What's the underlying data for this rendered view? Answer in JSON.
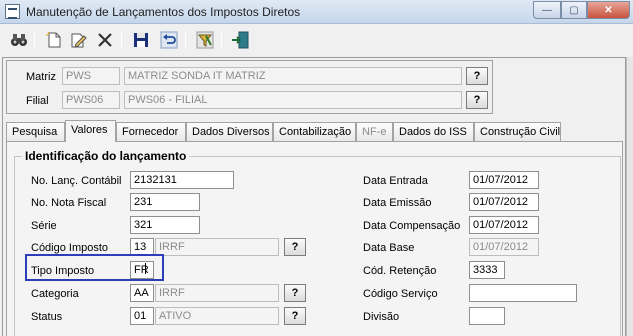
{
  "window": {
    "title": "Manutenção de Lançamentos dos Impostos Diretos",
    "icon": "app-window-icon",
    "controls": {
      "minimize": "—",
      "maximize": "▢",
      "close": "✕"
    }
  },
  "toolbar": {
    "buttons": [
      "binoculars-icon",
      "new-document-icon",
      "edit-document-icon",
      "delete-icon",
      "save-disk-icon",
      "undo-icon",
      "filter-icon",
      "exit-door-icon"
    ]
  },
  "header": {
    "matriz": {
      "label": "Matriz",
      "code": "PWS",
      "name": "MATRIZ SONDA IT MATRIZ",
      "button": "?"
    },
    "filial": {
      "label": "Filial",
      "code": "PWS06",
      "name": "PWS06 - FILIAL",
      "button": "?"
    }
  },
  "tabs": [
    {
      "label": "Pesquisa"
    },
    {
      "label": "Valores"
    },
    {
      "label": "Fornecedor"
    },
    {
      "label": "Dados Diversos"
    },
    {
      "label": "Contabilização"
    },
    {
      "label": "NF-e"
    },
    {
      "label": "Dados do ISS"
    },
    {
      "label": "Construção Civil"
    }
  ],
  "section": {
    "title": "Identificação do lançamento",
    "left": {
      "no_lanc_contabil": {
        "label": "No. Lanç. Contábil",
        "value": "2132131"
      },
      "no_nota_fiscal": {
        "label": "No. Nota Fiscal",
        "value": "231"
      },
      "serie": {
        "label": "Série",
        "value": "321"
      },
      "codigo_imposto": {
        "label": "Código Imposto",
        "code": "13",
        "desc": "IRRF",
        "button": "?"
      },
      "tipo_imposto": {
        "label": "Tipo Imposto",
        "value": "FR"
      },
      "categoria": {
        "label": "Categoria",
        "code": "AA",
        "desc": "IRRF",
        "button": "?"
      },
      "status": {
        "label": "Status",
        "code": "01",
        "desc": "ATIVO",
        "button": "?"
      }
    },
    "right": {
      "data_entrada": {
        "label": "Data Entrada",
        "value": "01/07/2012"
      },
      "data_emissao": {
        "label": "Data Emissão",
        "value": "01/07/2012"
      },
      "data_compensacao": {
        "label": "Data Compensação",
        "value": "01/07/2012"
      },
      "data_base": {
        "label": "Data Base",
        "value": "01/07/2012"
      },
      "cod_retencao": {
        "label": "Cód. Retenção",
        "value": "3333"
      },
      "codigo_servico": {
        "label": "Código Serviço",
        "value": ""
      },
      "divisao": {
        "label": "Divisão",
        "value": ""
      }
    }
  },
  "colors": {
    "highlight_border": "#2e3db8",
    "titlebar": "#c6d7ec"
  }
}
